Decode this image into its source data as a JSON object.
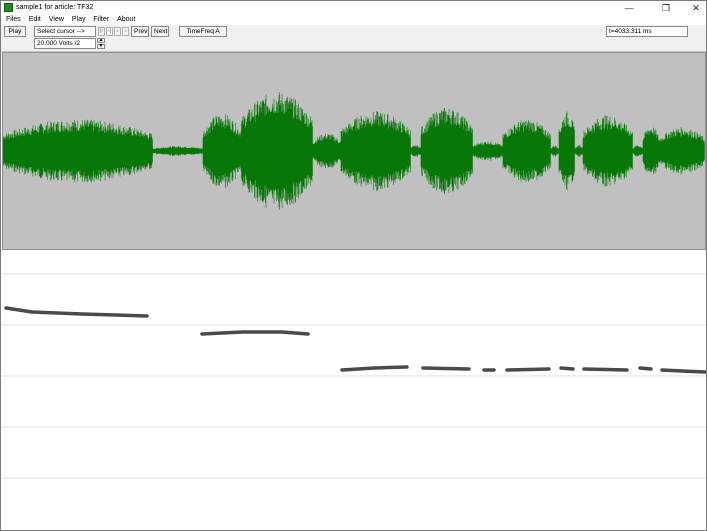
{
  "window": {
    "title": "sample1 for article: TF32"
  },
  "titlebar": {
    "minimize": "—",
    "maximize": "❐",
    "close": "✕"
  },
  "menu": [
    "Files",
    "Edit",
    "View",
    "Play",
    "Filter",
    "About"
  ],
  "toolbar": {
    "play_label": "Play",
    "select_cursor_label": "Select cursor -->",
    "volts_label": "20.000 Volts /2",
    "spin_up": "▲",
    "spin_down": "▼",
    "nav_icons": [
      "|‹",
      "‹|",
      "‹",
      "›"
    ],
    "prev_label": "Prev",
    "next_label": "Next",
    "timefreq_label": "TimeFreq A",
    "time_readout": "t=4033.311 ms"
  },
  "colors": {
    "waveform": "#077707",
    "waveform_bg": "#c0c0c0",
    "trace": "#2a2a2a",
    "grid": "#dcdcdc"
  }
}
